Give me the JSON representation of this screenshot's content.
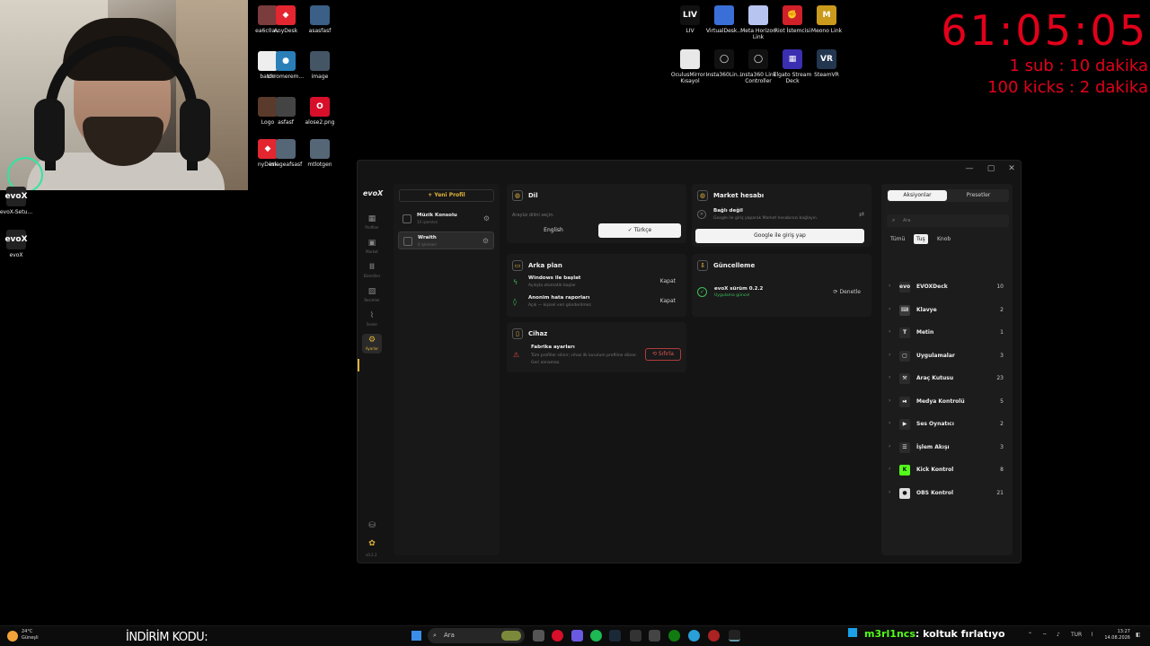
{
  "timer": {
    "clock": "61:05:05",
    "line1": "1 sub : 10 dakika",
    "line2": "100 kicks : 2 dakika"
  },
  "desktop": {
    "icons": [
      {
        "label": "ea6c0a...",
        "color": "#7a3c3c",
        "glyph": ""
      },
      {
        "label": "AnyDesk",
        "color": "#e3262f",
        "glyph": "◆"
      },
      {
        "label": "asasfasf",
        "color": "#3b5f86",
        "glyph": ""
      },
      {
        "label": "baton",
        "color": "#eeeeee",
        "glyph": ""
      },
      {
        "label": "chromerem...",
        "color": "#2a7fb8",
        "glyph": "●"
      },
      {
        "label": "image",
        "color": "#445566",
        "glyph": ""
      },
      {
        "label": "Logo",
        "color": "#5a3a2a",
        "glyph": ""
      },
      {
        "label": "asfasf",
        "color": "#444444",
        "glyph": ""
      },
      {
        "label": "alose2.png",
        "color": "#d80f2a",
        "glyph": "O"
      },
      {
        "label": "nyDesk",
        "color": "#e3262f",
        "glyph": "◆"
      },
      {
        "label": "imageafsasf",
        "color": "#556677",
        "glyph": ""
      },
      {
        "label": "mtlotgen",
        "color": "#556677",
        "glyph": ""
      },
      {
        "label": "evoX-Setu...",
        "color": "#222222",
        "glyph": "evoX"
      },
      {
        "label": "evoX",
        "color": "#222222",
        "glyph": "evoX"
      },
      {
        "label": "LIV",
        "color": "#111111",
        "glyph": "LIV"
      },
      {
        "label": "VirtualDesk...",
        "color": "#3a6fd8",
        "glyph": ""
      },
      {
        "label": "Meta Horizon Link",
        "color": "#b8c4f0",
        "glyph": ""
      },
      {
        "label": "Riot İstemcisi",
        "color": "#d0202a",
        "glyph": "✊"
      },
      {
        "label": "Meono Link",
        "color": "#c99a1c",
        "glyph": "M"
      },
      {
        "label": "OculusMirror - Kısayol",
        "color": "#e8e8e8",
        "glyph": ""
      },
      {
        "label": "Insta360Lin...",
        "color": "#111111",
        "glyph": "◯"
      },
      {
        "label": "Insta360 Link Controller",
        "color": "#111111",
        "glyph": "◯"
      },
      {
        "label": "Elgato Stream Deck",
        "color": "#3a2fb0",
        "glyph": "▦"
      },
      {
        "label": "SteamVR",
        "color": "#23364f",
        "glyph": "VR"
      }
    ]
  },
  "app": {
    "logo": "evoX",
    "version": "v0.2.2",
    "rail": [
      {
        "icon": "grid-icon",
        "glyph": "▦",
        "label": "Profiller"
      },
      {
        "icon": "market-icon",
        "glyph": "▣",
        "label": "Market"
      },
      {
        "icon": "stats-icon",
        "glyph": "Ⅲ",
        "label": "Eklentiler"
      },
      {
        "icon": "image-icon",
        "glyph": "▨",
        "label": "Resimler"
      },
      {
        "icon": "chart-icon",
        "glyph": "⌇",
        "label": "Sesler"
      },
      {
        "icon": "settings-icon",
        "glyph": "⚙",
        "label": "Ayarlar"
      }
    ],
    "new_profile": "+ Yeni Profil",
    "profiles": [
      {
        "name": "Müzik Konsolu",
        "sub": "10 işlemleri"
      },
      {
        "name": "Wraith",
        "sub": "0 işlemleri"
      }
    ],
    "lang_card": {
      "title": "Dil",
      "desc": "Arayüz dilini seçin.",
      "opt1": "English",
      "opt2": "✓ Türkçe"
    },
    "market_card": {
      "title": "Market hesabı",
      "status": "Bağlı değil",
      "desc": "Google ile giriş yaparak Market hesabınızı bağlayın.",
      "button": "Google ile giriş yap"
    },
    "bg_card": {
      "title": "Arka plan",
      "row1_title": "Windows ile başlat",
      "row1_desc": "Açılışta otomatik başlar",
      "row1_value": "Kapat",
      "row2_title": "Anonim hata raporları",
      "row2_desc": "Açık — kişisel veri gönderilmez",
      "row2_value": "Kapat"
    },
    "update_card": {
      "title": "Güncelleme",
      "version": "evoX sürüm 0.2.2",
      "status": "Uygulama güncel",
      "button": "Denetle"
    },
    "device_card": {
      "title": "Cihaz",
      "row_title": "Fabrika ayarları",
      "row_desc": "Tüm profiller silinir; cihaz ilk kurulum profiline döner. Geri alınamaz.",
      "button": "Sıfırla"
    },
    "actions": {
      "tab1": "Aksiyonlar",
      "tab2": "Presetler",
      "search_placeholder": "Ara",
      "filters": [
        "Tümü",
        "Tuş",
        "Knob"
      ],
      "categories": [
        {
          "name": "EVOXDeck",
          "count": "10",
          "color": "#2b2b2b",
          "glyph": "evo"
        },
        {
          "name": "Klavye",
          "count": "2",
          "color": "#3a3a3a",
          "glyph": "⌨"
        },
        {
          "name": "Metin",
          "count": "1",
          "color": "#2b2b2b",
          "glyph": "T"
        },
        {
          "name": "Uygulamalar",
          "count": "3",
          "color": "#2b2b2b",
          "glyph": "▢"
        },
        {
          "name": "Araç Kutusu",
          "count": "23",
          "color": "#2b2b2b",
          "glyph": "⚒"
        },
        {
          "name": "Medya Kontrolü",
          "count": "5",
          "color": "#2b2b2b",
          "glyph": "⏯"
        },
        {
          "name": "Ses Oynatıcı",
          "count": "2",
          "color": "#2b2b2b",
          "glyph": "▶"
        },
        {
          "name": "İşlem Akışı",
          "count": "3",
          "color": "#2b2b2b",
          "glyph": "☰"
        },
        {
          "name": "Kick Kontrol",
          "count": "8",
          "color": "#53fc18",
          "glyph": "K"
        },
        {
          "name": "OBS Kontrol",
          "count": "21",
          "color": "#dddddd",
          "glyph": "●"
        }
      ]
    }
  },
  "taskbar": {
    "weather_temp": "24°C",
    "weather_desc": "Güneşli",
    "promo": "İNDİRİM KODU:",
    "search_placeholder": "Ara",
    "chat_user": "m3rl1ncs",
    "chat_text": ": koltuk fırlatıyo",
    "lang": "TUR",
    "time": "13:27",
    "date": "14.08.2026"
  }
}
